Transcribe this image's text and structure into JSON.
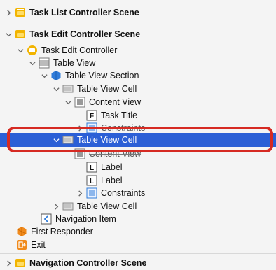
{
  "outline": {
    "rows": [
      {
        "label": "Task List Controller Scene",
        "bold": true
      },
      {
        "label": "Task Edit Controller Scene",
        "bold": true
      },
      {
        "label": "Task Edit Controller"
      },
      {
        "label": "Table View"
      },
      {
        "label": "Table View Section"
      },
      {
        "label": "Table View Cell"
      },
      {
        "label": "Content View"
      },
      {
        "label": "Task Title",
        "glyph": "F"
      },
      {
        "label": "Constraints"
      },
      {
        "label": "Table View Cell"
      },
      {
        "label": "Content View"
      },
      {
        "label": "Label",
        "glyph": "L"
      },
      {
        "label": "Label",
        "glyph": "L"
      },
      {
        "label": "Constraints"
      },
      {
        "label": "Table View Cell"
      },
      {
        "label": "Navigation Item",
        "glyph": "<"
      },
      {
        "label": "First Responder"
      },
      {
        "label": "Exit"
      },
      {
        "label": "Navigation Controller Scene",
        "bold": true
      }
    ]
  },
  "colors": {
    "selection": "#2b5fd6",
    "highlight": "#d62a22",
    "scene": "#f2b400"
  }
}
